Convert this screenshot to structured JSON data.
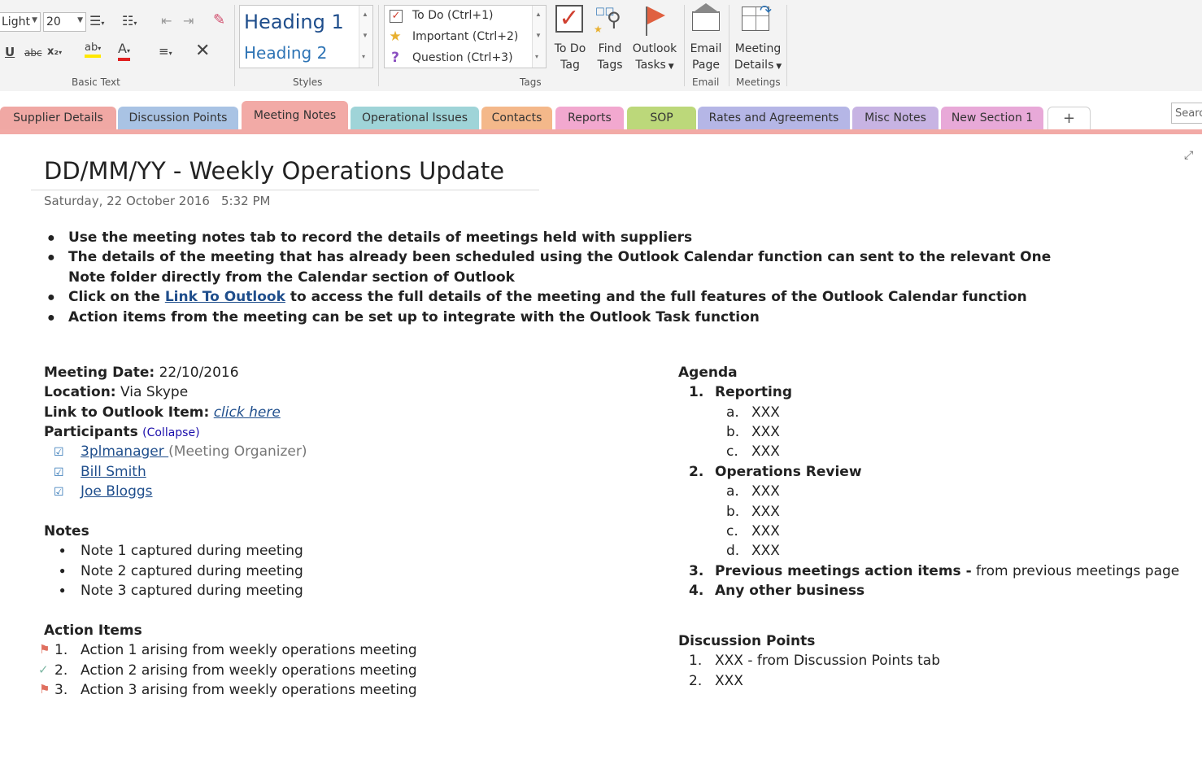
{
  "ribbon": {
    "basic_text": {
      "font_name": "Light",
      "font_size": "20",
      "label": "Basic Text",
      "strike_label": "abc",
      "sub_label": "x₂",
      "highlight_label": "ab",
      "font_color_label": "A"
    },
    "styles": {
      "heading1": "Heading 1",
      "heading2": "Heading 2",
      "label": "Styles"
    },
    "tags": {
      "items": [
        "To Do (Ctrl+1)",
        "Important (Ctrl+2)",
        "Question (Ctrl+3)"
      ],
      "todo_tag": [
        "To Do",
        "Tag"
      ],
      "find_tags": [
        "Find",
        "Tags"
      ],
      "outlook_tasks": [
        "Outlook",
        "Tasks"
      ],
      "label": "Tags"
    },
    "email": {
      "button": [
        "Email",
        "Page"
      ],
      "label": "Email"
    },
    "meetings": {
      "button": [
        "Meeting",
        "Details"
      ],
      "label": "Meetings"
    }
  },
  "tabs": [
    {
      "label": "Supplier Details",
      "color": "#f0a8a4"
    },
    {
      "label": "Discussion Points",
      "color": "#a9c3e4"
    },
    {
      "label": "Meeting Notes",
      "color": "#f2aaa6",
      "active": true
    },
    {
      "label": "Operational Issues",
      "color": "#9fd4d8"
    },
    {
      "label": "Contacts",
      "color": "#f4b88a"
    },
    {
      "label": "Reports",
      "color": "#f2a8cf"
    },
    {
      "label": "SOP",
      "color": "#bcd87a"
    },
    {
      "label": "Rates and Agreements",
      "color": "#b5b6e6"
    },
    {
      "label": "Misc Notes",
      "color": "#c7b3e3"
    },
    {
      "label": "New Section 1",
      "color": "#e8a9d8"
    },
    {
      "label": "+"
    }
  ],
  "search_placeholder": "Searc",
  "page": {
    "title": "DD/MM/YY - Weekly Operations Update",
    "date": "Saturday, 22 October 2016",
    "time": "5:32 PM",
    "intro": {
      "b1": "Use the meeting notes tab to record the details of meetings held with suppliers",
      "b2_line1": "The details of the meeting that has already been scheduled using the Outlook Calendar function  can  sent to the relevant One",
      "b2_line2": "Note folder directly from the Calendar section of Outlook",
      "b3_pre": "Click on the ",
      "b3_link": "Link To Outlook",
      "b3_post": " to access the full details of the meeting and the full features of the Outlook Calendar function",
      "b4": "Action items from the meeting can be set up to integrate with the Outlook Task function"
    },
    "meeting": {
      "date_label": "Meeting Date:",
      "date_value": " 22/10/2016",
      "location_label": "Location:",
      "location_value": " Via Skype",
      "link_label": "Link to Outlook Item:",
      "link_value": "click here",
      "participants_label": "Participants",
      "collapse": "(Collapse)",
      "participants": [
        {
          "name": "3plmanager ",
          "role": "(Meeting Organizer)"
        },
        {
          "name": "Bill Smith",
          "role": ""
        },
        {
          "name": "Joe Bloggs",
          "role": ""
        }
      ]
    },
    "notes": {
      "heading": "Notes",
      "items": [
        "Note 1 captured during meeting",
        "Note 2 captured during meeting",
        "Note 3 captured during meeting"
      ]
    },
    "actions": {
      "heading": "Action Items",
      "items": [
        {
          "num": "1.",
          "text": "Action 1 arising from weekly operations meeting",
          "tag": "flag"
        },
        {
          "num": "2.",
          "text": "Action 2 arising from weekly operations meeting",
          "tag": "done"
        },
        {
          "num": "3.",
          "text": "Action 3 arising from weekly operations meeting",
          "tag": "flag"
        }
      ]
    },
    "agenda": {
      "heading": "Agenda",
      "i1_num": "1.",
      "i1": "Reporting",
      "i1_subs": [
        [
          "a.",
          "XXX"
        ],
        [
          "b.",
          "XXX"
        ],
        [
          "c.",
          "XXX"
        ]
      ],
      "i2_num": "2.",
      "i2": "Operations Review",
      "i2_subs": [
        [
          "a.",
          "XXX"
        ],
        [
          "b.",
          "XXX"
        ],
        [
          "c.",
          "XXX"
        ],
        [
          "d.",
          "XXX"
        ]
      ],
      "i3_num": "3.",
      "i3_bold": "Previous meetings action items -",
      "i3_rest": " from previous meetings page",
      "i4_num": "4.",
      "i4": "Any other business"
    },
    "discussion": {
      "heading": "Discussion Points",
      "items": [
        [
          "1.",
          "XXX - from Discussion Points tab"
        ],
        [
          "2.",
          "XXX"
        ]
      ]
    }
  }
}
